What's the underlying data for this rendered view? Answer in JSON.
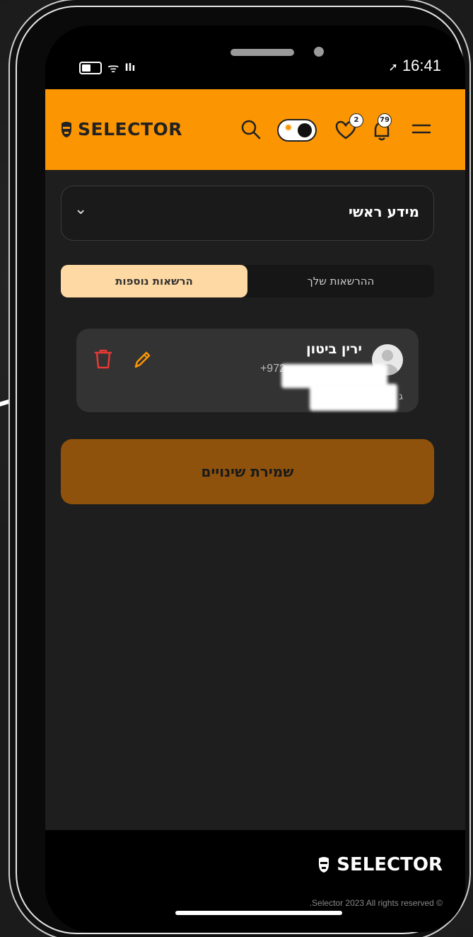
{
  "status_bar": {
    "time": "16:41"
  },
  "header": {
    "brand": "SELECTOR",
    "favorites_count": "2",
    "notifications_count": "79"
  },
  "section_dropdown": {
    "label": "מידע ראשי"
  },
  "tabs": [
    {
      "label": "הרשאות נוספות",
      "active": true
    },
    {
      "label": "ההרשאות שלך",
      "active": false
    }
  ],
  "user_card": {
    "name": "ירין ביטון",
    "phone": "+972",
    "role": "ג"
  },
  "save_button": {
    "label": "שמירת שינויים"
  },
  "footer": {
    "brand": "SELECTOR",
    "copyright": ".Selector 2023 All rights reserved ©"
  },
  "colors": {
    "accent": "#fb9502",
    "save": "#8f520c",
    "active_tab": "#ffd9a3",
    "delete": "#e53935"
  }
}
